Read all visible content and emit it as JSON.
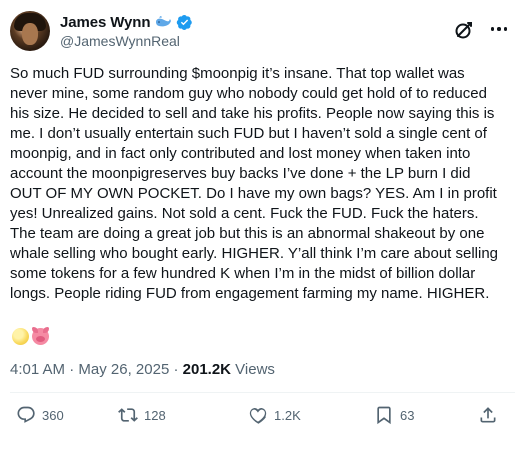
{
  "author": {
    "display_name": "James Wynn",
    "handle": "@JamesWynnReal",
    "badges": [
      "whale-icon",
      "verified-badge-icon"
    ]
  },
  "header_actions": [
    "grok-icon",
    "more-options-icon"
  ],
  "tweet": {
    "text": "So much FUD surrounding $moonpig it’s insane. That top wallet was\nnever mine, some random guy who nobody could get hold of to reduced\nhis size. He decided to sell and take his profits. People now saying this is\nme. I don’t usually entertain such FUD but I haven’t sold a single cent of\nmoonpig, and in fact only contributed and lost money when taken into\naccount the moonpigreserves buy backs I’ve done + the LP burn I did\nOUT OF MY OWN POCKET. Do I have my own bags? YES. Am I in profit\nyes! Unrealized gains. Not sold a cent. Fuck the FUD. Fuck the haters.\nThe team are doing a great job but this is an abnormal shakeout by one\nwhale selling who bought early. HIGHER. Y’all think I’m care about selling\nsome tokens for a few hundred K when I’m in the midst of billion dollar\nlongs. People riding FUD from engagement farming my name. HIGHER.",
    "emojis": [
      "moon-emoji",
      "pig-emoji"
    ]
  },
  "meta": {
    "time": "4:01 AM",
    "separator": " · ",
    "date": "May 26, 2025",
    "views_count": "201.2K",
    "views_label": " Views"
  },
  "actions": {
    "replies": "360",
    "reposts": "128",
    "likes": "1.2K",
    "views": "",
    "bookmarks": "63"
  },
  "colors": {
    "text": "#0f1419",
    "secondary": "#536471",
    "verified": "#1d9bf0",
    "divider": "#eff3f4"
  }
}
